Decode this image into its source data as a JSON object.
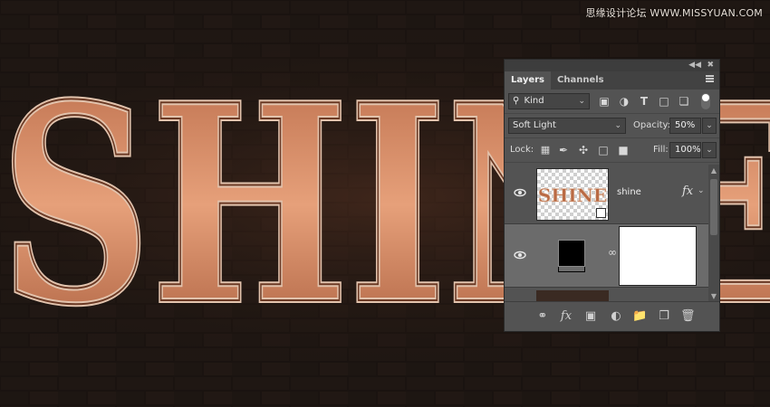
{
  "canvas": {
    "text": "SHINE",
    "bg_color": "#140f0c",
    "brick_color": "#1c1511",
    "letter_color": "#c97c56",
    "rim_color": "#d8b6a0"
  },
  "watermark": "思缘设计论坛  WWW.MISSYUAN.COM",
  "panel": {
    "tabs": [
      {
        "label": "Layers",
        "active": true
      },
      {
        "label": "Channels",
        "active": false
      }
    ],
    "filter": {
      "kind_label": "Kind",
      "icons": [
        "image-filter-icon",
        "adjustment-filter-icon",
        "type-filter-icon",
        "shape-filter-icon",
        "smart-object-filter-icon",
        "filter-toggle-icon"
      ]
    },
    "blend": {
      "mode": "Soft Light",
      "opacity_label": "Opacity:",
      "opacity_value": "50%"
    },
    "lock": {
      "lock_label": "Lock:",
      "icons": [
        "lock-transparent-icon",
        "lock-image-icon",
        "lock-position-icon",
        "lock-artboard-icon",
        "lock-all-icon"
      ],
      "fill_label": "Fill:",
      "fill_value": "100%"
    },
    "layers": [
      {
        "name": "shine",
        "visible": true,
        "type": "smart-object",
        "fx": "fx",
        "thumb_text": "SHINE"
      },
      {
        "name": "",
        "visible": true,
        "type": "adjustment-with-mask"
      }
    ],
    "bottom_icons": [
      "link-layers-icon",
      "fx-icon",
      "add-mask-icon",
      "adjustment-layer-icon",
      "group-folder-icon",
      "new-layer-icon",
      "trash-icon"
    ]
  }
}
